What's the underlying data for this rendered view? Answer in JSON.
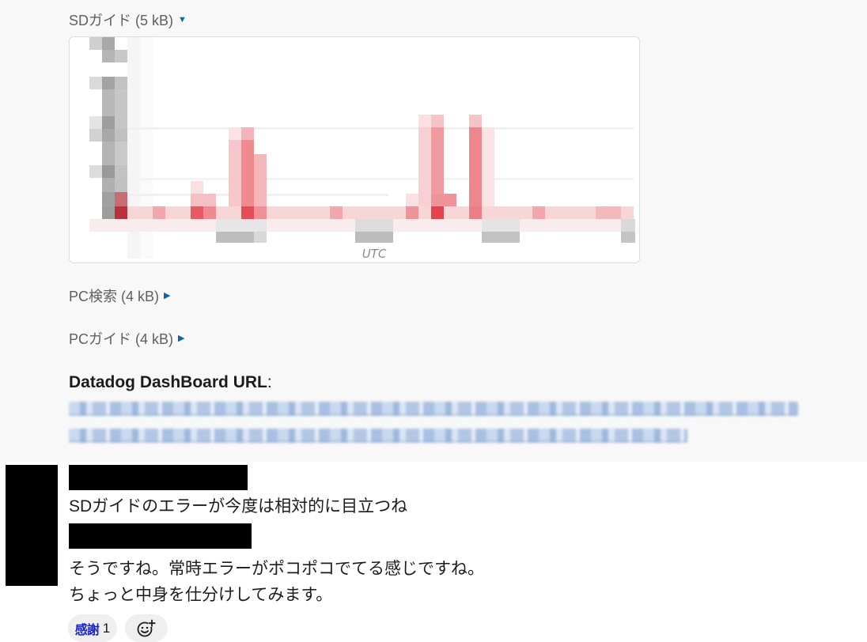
{
  "attachments": [
    {
      "label": "SDガイド (5 kB)",
      "expanded": true
    },
    {
      "label": "PC検索 (4 kB)",
      "expanded": false
    },
    {
      "label": "PCガイド (4 kB)",
      "expanded": false
    }
  ],
  "preview": {
    "axis_text": "UTC"
  },
  "datadog": {
    "title": "Datadog DashBoard URL",
    "colon": ":"
  },
  "messages": [
    {
      "text": "SDガイドのエラーが今度は相対的に目立つね"
    },
    {
      "lines": [
        "そうですね。常時エラーがポコポコでてる感じですね。",
        "ちょっと中身を仕分けしてみます。"
      ]
    }
  ],
  "reactions": [
    {
      "emoji_text": "感謝",
      "count": "1"
    }
  ],
  "icons": {
    "expand_caret": "caret-down-icon",
    "collapse_caret": "caret-right-icon",
    "add_reaction": "add-reaction-icon"
  },
  "colors": {
    "link": "#1264a3",
    "reaction_bg": "#efefef",
    "emoji_kansha": "#1a22c8",
    "chart_error": "#e8444e"
  }
}
